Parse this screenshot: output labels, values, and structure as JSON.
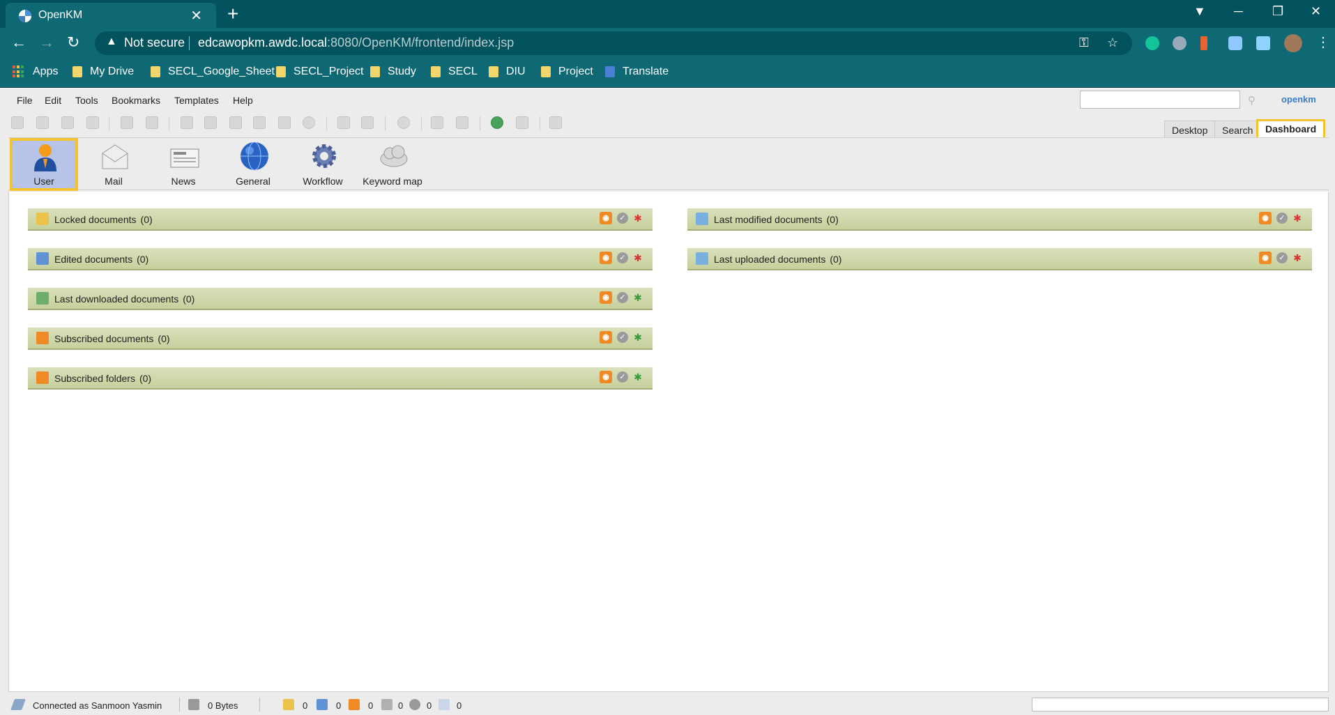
{
  "browser": {
    "tab_title": "OpenKM",
    "tab_close": "✕",
    "new_tab": "+",
    "security_label": "Not secure",
    "url_host": "edcawopkm.awdc.local",
    "url_rest": ":8080/OpenKM/frontend/index.jsp",
    "bookmarks": [
      "Apps",
      "My Drive",
      "SECL_Google_Sheet",
      "SECL_Project",
      "Study",
      "SECL",
      "DIU",
      "Project",
      "Translate"
    ]
  },
  "menu": {
    "items": [
      "File",
      "Edit",
      "Tools",
      "Bookmarks",
      "Templates",
      "Help"
    ],
    "logo": "openkm"
  },
  "view_tabs": [
    "Desktop",
    "Search",
    "Dashboard"
  ],
  "dashboard_tabs": [
    "User",
    "Mail",
    "News",
    "General",
    "Workflow",
    "Keyword map"
  ],
  "panels_left": [
    {
      "title": "Locked documents",
      "count": "(0)"
    },
    {
      "title": "Edited documents",
      "count": "(0)"
    },
    {
      "title": "Last downloaded documents",
      "count": "(0)"
    },
    {
      "title": "Subscribed documents",
      "count": "(0)"
    },
    {
      "title": "Subscribed folders",
      "count": "(0)"
    }
  ],
  "panels_right": [
    {
      "title": "Last modified documents",
      "count": "(0)"
    },
    {
      "title": "Last uploaded documents",
      "count": "(0)"
    }
  ],
  "status": {
    "connected": "Connected as Sanmoon Yasmin",
    "size": "0 Bytes",
    "counts": [
      "0",
      "0",
      "0",
      "0",
      "0",
      "0"
    ]
  },
  "colors": {
    "chrome_dark": "#03535e",
    "chrome_mid": "#0e6975",
    "panel_header": "#c6d09c",
    "highlight": "#f4c430",
    "active_tab_bg": "#b7c4e7"
  }
}
